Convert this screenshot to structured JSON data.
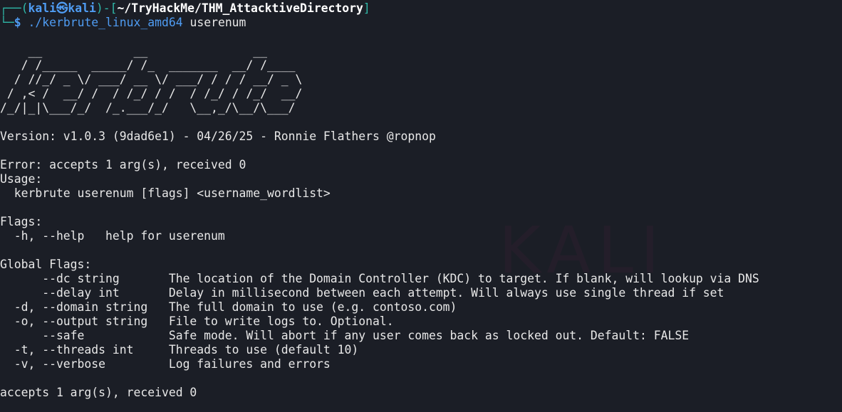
{
  "prompt": {
    "user": "kali",
    "host": "kali",
    "cwd": "~/TryHackMe/THM_AttacktiveDirectory",
    "command": "./kerbrute_linux_amd64",
    "args": " userenum",
    "colors": {
      "frame": "#2fb8a8",
      "user": "#4f9cf2",
      "path": "#ffffff"
    }
  },
  "banner": [
    "    __             __               __     ",
    "   / /_____  _____/ /_  _______  __/ /____ ",
    "  / //_/ _ \\/ ___/ __ \\/ ___/ / / / __/ _ \\",
    " / ,< /  __/ /  / /_/ / /  / /_/ / /_/  __/",
    "/_/|_|\\___/_/  /_.___/_/   \\__,_/\\__/\\___/ "
  ],
  "output": [
    "",
    "Version: v1.0.3 (9dad6e1) - 04/26/25 - Ronnie Flathers @ropnop",
    "",
    "Error: accepts 1 arg(s), received 0",
    "Usage:",
    "  kerbrute userenum [flags] <username_wordlist>",
    "",
    "Flags:",
    "  -h, --help   help for userenum",
    "",
    "Global Flags:",
    "      --dc string       The location of the Domain Controller (KDC) to target. If blank, will lookup via DNS",
    "      --delay int       Delay in millisecond between each attempt. Will always use single thread if set",
    "  -d, --domain string   The full domain to use (e.g. contoso.com)",
    "  -o, --output string   File to write logs to. Optional.",
    "      --safe            Safe mode. Will abort if any user comes back as locked out. Default: FALSE",
    "  -t, --threads int     Threads to use (default 10)",
    "  -v, --verbose         Log failures and errors",
    "",
    "accepts 1 arg(s), received 0"
  ]
}
